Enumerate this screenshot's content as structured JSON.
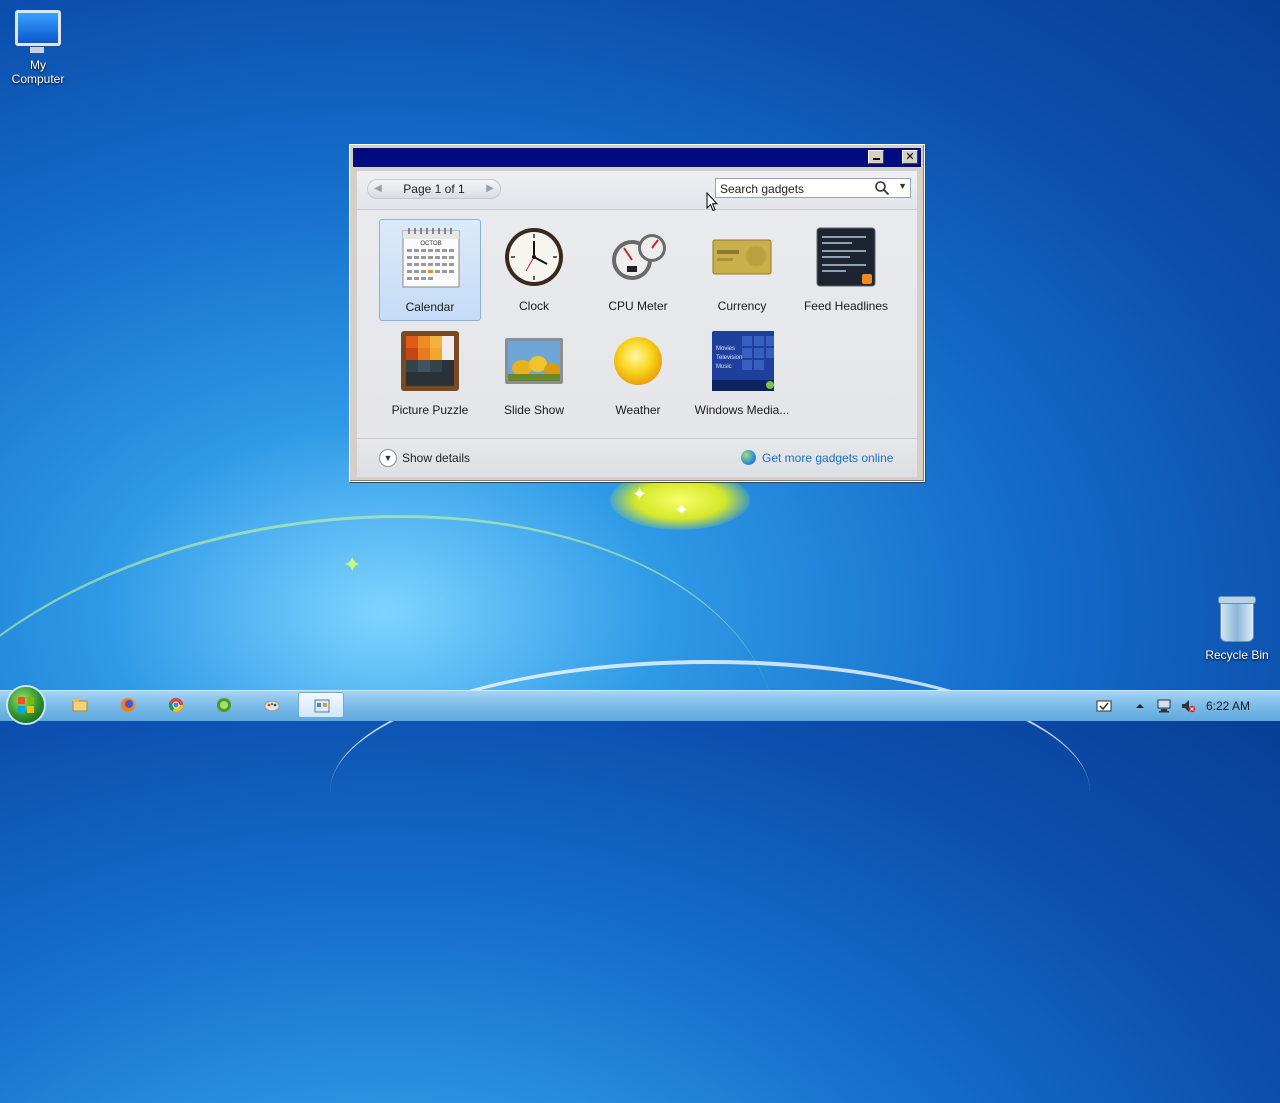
{
  "desktop": {
    "icons": [
      {
        "label_line1": "My",
        "label_line2": "Computer"
      },
      {
        "label": "Recycle Bin"
      }
    ]
  },
  "window": {
    "pager_text": "Page 1 of 1",
    "search_placeholder": "Search gadgets",
    "gadgets": [
      {
        "label": "Calendar",
        "icon": "calendar-icon",
        "selected": true
      },
      {
        "label": "Clock",
        "icon": "clock-icon"
      },
      {
        "label": "CPU Meter",
        "icon": "cpu-meter-icon"
      },
      {
        "label": "Currency",
        "icon": "currency-icon"
      },
      {
        "label": "Feed Headlines",
        "icon": "feed-headlines-icon"
      },
      {
        "label": "Picture Puzzle",
        "icon": "picture-puzzle-icon"
      },
      {
        "label": "Slide Show",
        "icon": "slide-show-icon"
      },
      {
        "label": "Weather",
        "icon": "weather-icon"
      },
      {
        "label": "Windows Media...",
        "icon": "windows-media-icon"
      }
    ],
    "show_details": "Show details",
    "get_more_online": "Get more gadgets online",
    "calendar_month": "OCTOB",
    "media_items": [
      "Movies",
      "Television",
      "Music"
    ]
  },
  "taskbar": {
    "apps": [
      "file-explorer-icon",
      "firefox-icon",
      "chrome-icon",
      "xbox-icon",
      "paint-icon",
      "gadgets-app-icon"
    ],
    "clock": "6:22 AM"
  },
  "colors": {
    "titlebar": "#000c80",
    "selection": "#c4dcf5",
    "link": "#1a6fc9"
  }
}
